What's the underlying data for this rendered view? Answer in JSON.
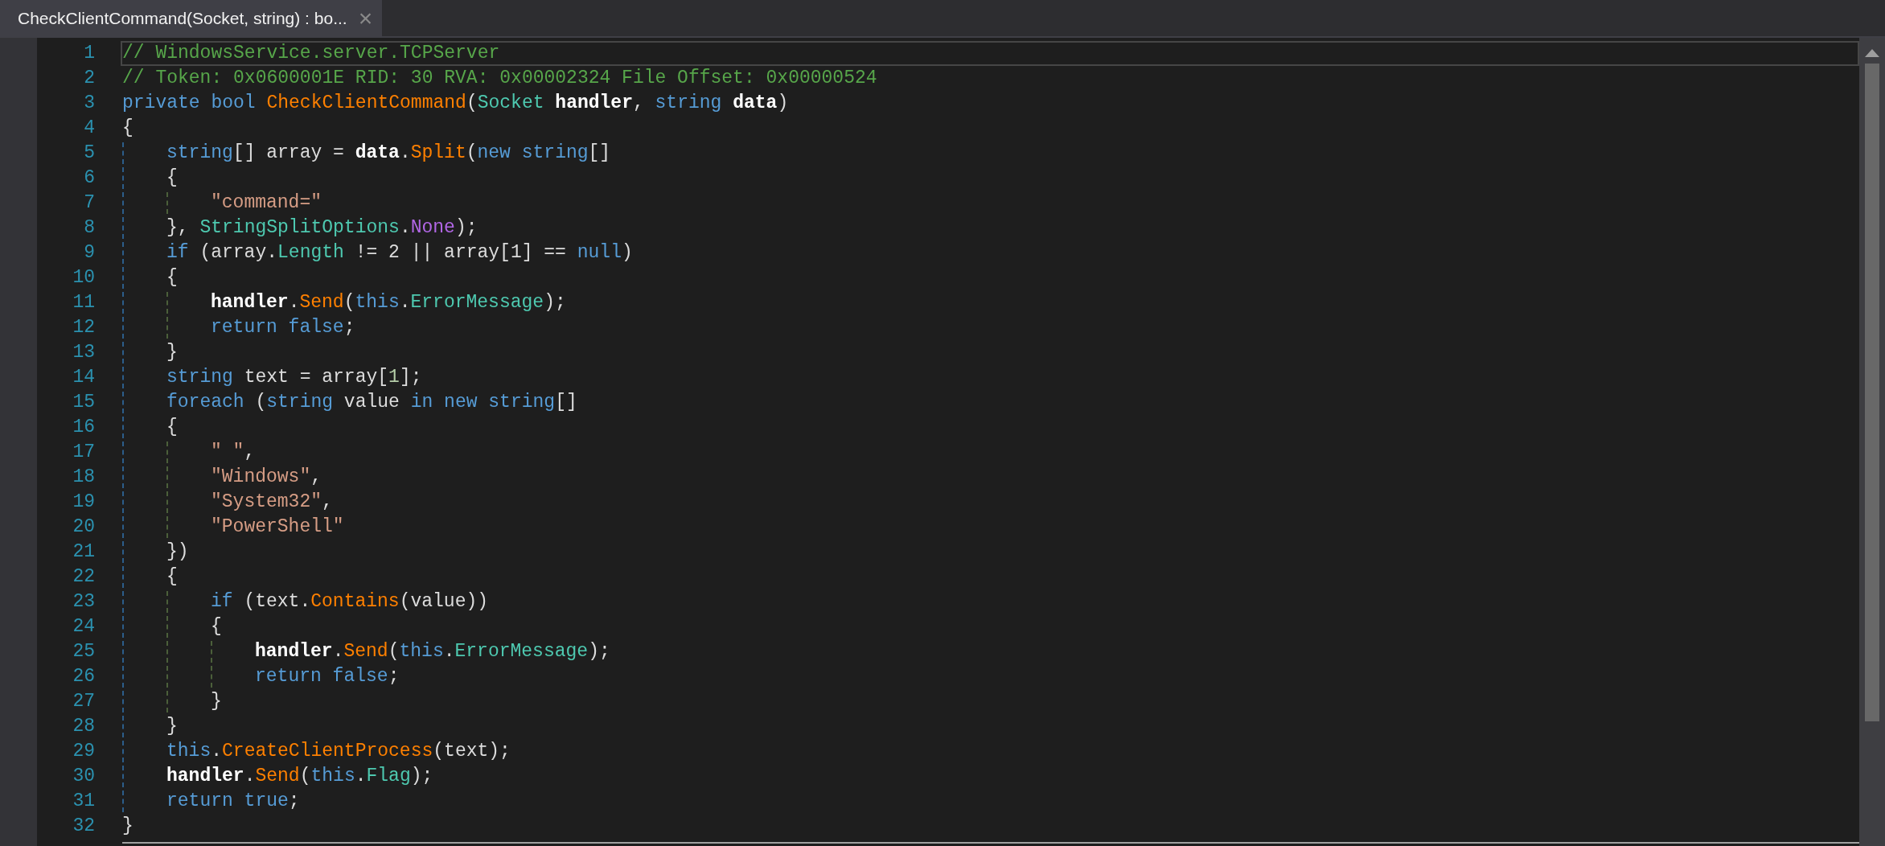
{
  "tabs": [
    {
      "label": "CheckClientCommand(Socket, string) : bo...",
      "selected": true,
      "close": "×"
    }
  ],
  "editor": {
    "lines": [
      {
        "number": "1",
        "current": true,
        "tokens": [
          {
            "kind": "comment",
            "text": "// WindowsService.server.TCPServer"
          }
        ]
      },
      {
        "number": "2",
        "current": false,
        "tokens": [
          {
            "kind": "comment",
            "text": "// Token: 0x0600001E RID: 30 RVA: 0x00002324 File Offset: 0x00000524"
          }
        ]
      },
      {
        "number": "3",
        "current": false,
        "tokens": [
          {
            "kind": "kw",
            "text": "private bool "
          },
          {
            "kind": "method",
            "text": "CheckClientCommand"
          },
          {
            "kind": "plain",
            "text": "("
          },
          {
            "kind": "type",
            "text": "Socket"
          },
          {
            "kind": "bold",
            "text": " handler"
          },
          {
            "kind": "plain",
            "text": ", "
          },
          {
            "kind": "kw",
            "text": "string"
          },
          {
            "kind": "bold",
            "text": " data"
          },
          {
            "kind": "plain",
            "text": ")"
          }
        ]
      },
      {
        "number": "4",
        "current": false,
        "tokens": [
          {
            "kind": "plain",
            "text": "{"
          }
        ]
      },
      {
        "number": "5",
        "current": false,
        "tokens": [
          {
            "kind": "kw",
            "text": "    string"
          },
          {
            "kind": "plain",
            "text": "[] array = "
          },
          {
            "kind": "bold",
            "text": "data"
          },
          {
            "kind": "plain",
            "text": "."
          },
          {
            "kind": "method",
            "text": "Split"
          },
          {
            "kind": "plain",
            "text": "("
          },
          {
            "kind": "kw",
            "text": "new string"
          },
          {
            "kind": "plain",
            "text": "[]"
          }
        ]
      },
      {
        "number": "6",
        "current": false,
        "tokens": [
          {
            "kind": "plain",
            "text": "    {"
          }
        ]
      },
      {
        "number": "7",
        "current": false,
        "tokens": [
          {
            "kind": "string",
            "text": "        \"command=\""
          }
        ]
      },
      {
        "number": "8",
        "current": false,
        "tokens": [
          {
            "kind": "plain",
            "text": "    }, "
          },
          {
            "kind": "type",
            "text": "StringSplitOptions"
          },
          {
            "kind": "plain",
            "text": "."
          },
          {
            "kind": "enum",
            "text": "None"
          },
          {
            "kind": "plain",
            "text": ");"
          }
        ]
      },
      {
        "number": "9",
        "current": false,
        "tokens": [
          {
            "kind": "kw",
            "text": "    if"
          },
          {
            "kind": "plain",
            "text": " (array."
          },
          {
            "kind": "type",
            "text": "Length"
          },
          {
            "kind": "plain",
            "text": " != 2 || array[1] == "
          },
          {
            "kind": "kw",
            "text": "null"
          },
          {
            "kind": "plain",
            "text": ")"
          }
        ]
      },
      {
        "number": "10",
        "current": false,
        "tokens": [
          {
            "kind": "plain",
            "text": "    {"
          }
        ]
      },
      {
        "number": "11",
        "current": false,
        "tokens": [
          {
            "kind": "bold",
            "text": "        handler"
          },
          {
            "kind": "plain",
            "text": "."
          },
          {
            "kind": "method",
            "text": "Send"
          },
          {
            "kind": "plain",
            "text": "("
          },
          {
            "kind": "kw",
            "text": "this"
          },
          {
            "kind": "plain",
            "text": "."
          },
          {
            "kind": "type",
            "text": "ErrorMessage"
          },
          {
            "kind": "plain",
            "text": ");"
          }
        ]
      },
      {
        "number": "12",
        "current": false,
        "tokens": [
          {
            "kind": "kw",
            "text": "        return false"
          },
          {
            "kind": "plain",
            "text": ";"
          }
        ]
      },
      {
        "number": "13",
        "current": false,
        "tokens": [
          {
            "kind": "plain",
            "text": "    }"
          }
        ]
      },
      {
        "number": "14",
        "current": false,
        "tokens": [
          {
            "kind": "kw",
            "text": "    string"
          },
          {
            "kind": "plain",
            "text": " text = array["
          },
          {
            "kind": "num",
            "text": "1"
          },
          {
            "kind": "plain",
            "text": "];"
          }
        ]
      },
      {
        "number": "15",
        "current": false,
        "tokens": [
          {
            "kind": "kw",
            "text": "    foreach"
          },
          {
            "kind": "plain",
            "text": " ("
          },
          {
            "kind": "kw",
            "text": "string"
          },
          {
            "kind": "plain",
            "text": " value "
          },
          {
            "kind": "kw",
            "text": "in new string"
          },
          {
            "kind": "plain",
            "text": "[]"
          }
        ]
      },
      {
        "number": "16",
        "current": false,
        "tokens": [
          {
            "kind": "plain",
            "text": "    {"
          }
        ]
      },
      {
        "number": "17",
        "current": false,
        "tokens": [
          {
            "kind": "string",
            "text": "        \" \""
          },
          {
            "kind": "plain",
            "text": ","
          }
        ]
      },
      {
        "number": "18",
        "current": false,
        "tokens": [
          {
            "kind": "string",
            "text": "        \"Windows\""
          },
          {
            "kind": "plain",
            "text": ","
          }
        ]
      },
      {
        "number": "19",
        "current": false,
        "tokens": [
          {
            "kind": "string",
            "text": "        \"System32\""
          },
          {
            "kind": "plain",
            "text": ","
          }
        ]
      },
      {
        "number": "20",
        "current": false,
        "tokens": [
          {
            "kind": "string",
            "text": "        \"PowerShell\""
          }
        ]
      },
      {
        "number": "21",
        "current": false,
        "tokens": [
          {
            "kind": "plain",
            "text": "    })"
          }
        ]
      },
      {
        "number": "22",
        "current": false,
        "tokens": [
          {
            "kind": "plain",
            "text": "    {"
          }
        ]
      },
      {
        "number": "23",
        "current": false,
        "tokens": [
          {
            "kind": "kw",
            "text": "        if"
          },
          {
            "kind": "plain",
            "text": " (text."
          },
          {
            "kind": "method",
            "text": "Contains"
          },
          {
            "kind": "plain",
            "text": "(value))"
          }
        ]
      },
      {
        "number": "24",
        "current": false,
        "tokens": [
          {
            "kind": "plain",
            "text": "        {"
          }
        ]
      },
      {
        "number": "25",
        "current": false,
        "tokens": [
          {
            "kind": "bold",
            "text": "            handler"
          },
          {
            "kind": "plain",
            "text": "."
          },
          {
            "kind": "method",
            "text": "Send"
          },
          {
            "kind": "plain",
            "text": "("
          },
          {
            "kind": "kw",
            "text": "this"
          },
          {
            "kind": "plain",
            "text": "."
          },
          {
            "kind": "type",
            "text": "ErrorMessage"
          },
          {
            "kind": "plain",
            "text": ");"
          }
        ]
      },
      {
        "number": "26",
        "current": false,
        "tokens": [
          {
            "kind": "kw",
            "text": "            return false"
          },
          {
            "kind": "plain",
            "text": ";"
          }
        ]
      },
      {
        "number": "27",
        "current": false,
        "tokens": [
          {
            "kind": "plain",
            "text": "        }"
          }
        ]
      },
      {
        "number": "28",
        "current": false,
        "tokens": [
          {
            "kind": "plain",
            "text": "    }"
          }
        ]
      },
      {
        "number": "29",
        "current": false,
        "tokens": [
          {
            "kind": "kw",
            "text": "    this"
          },
          {
            "kind": "plain",
            "text": ".CreateClientProcess",
            "accent": true
          },
          {
            "kind": "plain",
            "text": "(text);"
          }
        ]
      },
      {
        "number": "30",
        "current": false,
        "tokens": [
          {
            "kind": "bold",
            "text": "    handler"
          },
          {
            "kind": "plain",
            "text": "."
          },
          {
            "kind": "method",
            "text": "Send"
          },
          {
            "kind": "plain",
            "text": "("
          },
          {
            "kind": "kw",
            "text": "this"
          },
          {
            "kind": "plain",
            "text": "."
          },
          {
            "kind": "type",
            "text": "Flag"
          },
          {
            "kind": "plain",
            "text": ");"
          }
        ]
      },
      {
        "number": "31",
        "current": false,
        "tokens": [
          {
            "kind": "kw",
            "text": "    return true"
          },
          {
            "kind": "plain",
            "text": ";"
          }
        ]
      },
      {
        "number": "32",
        "current": false,
        "tokens": [
          {
            "kind": "plain",
            "text": "}"
          }
        ]
      }
    ]
  }
}
